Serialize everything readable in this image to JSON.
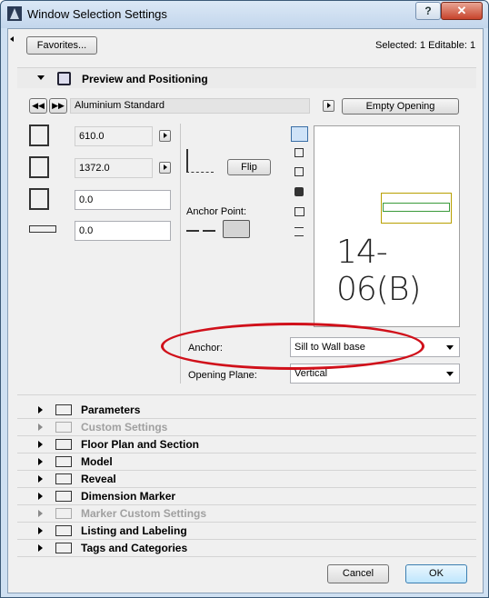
{
  "window": {
    "title": "Window Selection Settings",
    "help_label": "?",
    "close_label": "✕"
  },
  "top": {
    "favorites_label": "Favorites...",
    "selected_info": "Selected: 1 Editable: 1"
  },
  "preview": {
    "section_title": "Preview and Positioning",
    "library_part": "Aluminium Standard",
    "empty_opening_label": "Empty Opening",
    "width": "610.0",
    "height": "1372.0",
    "sill_height": "0.0",
    "reveal_depth": "0.0",
    "flip_label": "Flip",
    "anchor_point_label": "Anchor Point:",
    "preview_label": "14-06(B)",
    "anchor_label": "Anchor:",
    "anchor_value": "Sill to Wall base",
    "opening_plane_label": "Opening Plane:",
    "opening_plane_value": "Vertical"
  },
  "sections": [
    {
      "label": "Parameters",
      "enabled": true,
      "icon": "parameters-icon"
    },
    {
      "label": "Custom Settings",
      "enabled": false,
      "icon": "custom-settings-icon"
    },
    {
      "label": "Floor Plan and Section",
      "enabled": true,
      "icon": "floor-plan-icon"
    },
    {
      "label": "Model",
      "enabled": true,
      "icon": "model-icon"
    },
    {
      "label": "Reveal",
      "enabled": true,
      "icon": "reveal-icon"
    },
    {
      "label": "Dimension Marker",
      "enabled": true,
      "icon": "dimension-marker-icon"
    },
    {
      "label": "Marker Custom Settings",
      "enabled": false,
      "icon": "marker-custom-settings-icon"
    },
    {
      "label": "Listing and Labeling",
      "enabled": true,
      "icon": "listing-icon"
    },
    {
      "label": "Tags and Categories",
      "enabled": true,
      "icon": "tags-icon"
    }
  ],
  "footer": {
    "cancel_label": "Cancel",
    "ok_label": "OK"
  },
  "colors": {
    "annotation_red": "#d0101a",
    "preview_window_frame": "#b8a000",
    "preview_window_glass": "#3a9a3a"
  }
}
